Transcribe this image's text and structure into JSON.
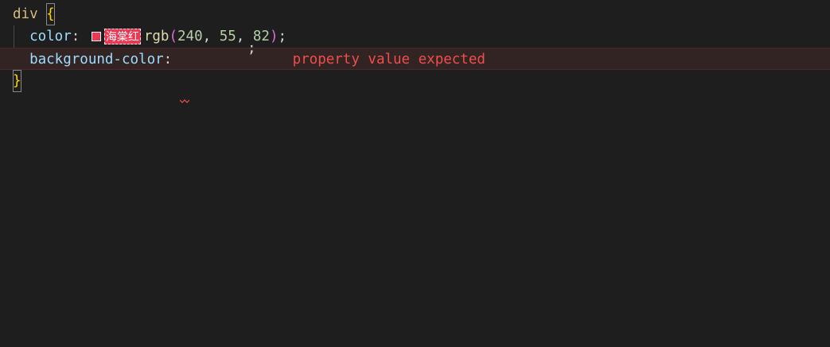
{
  "code": {
    "line1": {
      "selector": "div",
      "brace_open": "{"
    },
    "line2": {
      "property": "color",
      "colon": ":",
      "color_swatch": "#f03752",
      "color_name": "海棠红",
      "func": "rgb",
      "paren_open": "(",
      "r": "240",
      "comma1": ",",
      "g": "55",
      "comma2": ",",
      "b": "82",
      "paren_close": ")",
      "semicolon": ";"
    },
    "line3": {
      "property": "background-color",
      "colon": ":",
      "semicolon": ";",
      "error_message": "property value expected"
    },
    "line4": {
      "brace_close": "}"
    }
  },
  "colors": {
    "background": "#1e1e1e",
    "error_line_bg": "#332424",
    "error_text": "#f14c4c"
  }
}
